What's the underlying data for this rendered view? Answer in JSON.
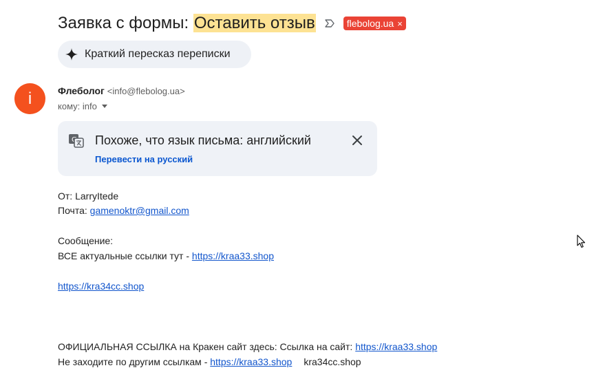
{
  "header": {
    "subject_prefix": "Заявка с формы: ",
    "subject_highlight": "Оставить отзыв",
    "label": "flebolog.ua",
    "label_close": "×"
  },
  "summary": {
    "label": "Краткий пересказ переписки"
  },
  "sender": {
    "avatar_letter": "i",
    "name": "Флеболог",
    "email": "<info@flebolog.ua>",
    "to": "кому: info"
  },
  "translate": {
    "title": "Похоже, что язык письма: английский",
    "link": "Перевести на русский"
  },
  "body": {
    "from_label": "От: ",
    "from_value": "LarryItede",
    "mail_label": "Почта: ",
    "mail_value": "gamenoktr@gmail.com",
    "message_label": "Сообщение:",
    "line1_text": "ВСЕ актуальные ссылки тут - ",
    "line1_link": "https://kraa33.shop",
    "line2_link": "https://kra34cc.shop",
    "line3_text": "ОФИЦИАЛЬНАЯ ССЫЛКА на Кракен сайт здесь: Ссылка на сайт:  ",
    "line3_link": "https://kraa33.shop",
    "line4_text": "Не заходите по другим ссылкам - ",
    "line4_link": "https://kraa33.shop",
    "line4_tail": "kra34cc.shop"
  },
  "colors": {
    "label_bg": "#ea4335",
    "highlight": "#fde293",
    "avatar_bg": "#f4511e",
    "link": "#1155cc",
    "translate_link": "#0b57d0"
  }
}
